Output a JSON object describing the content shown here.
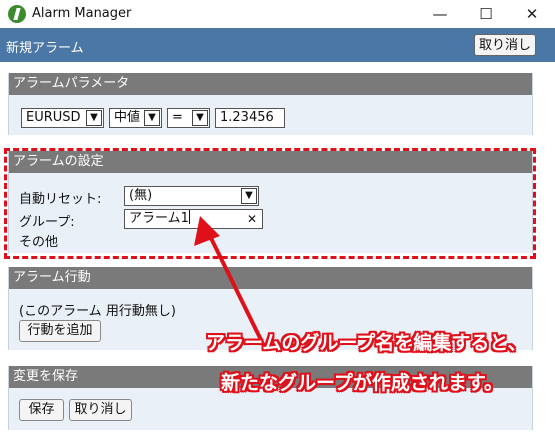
{
  "window": {
    "title": "Alarm Manager",
    "minimize": "—",
    "maximize": "☐",
    "close": "✕"
  },
  "appbar": {
    "title": "新規アラーム",
    "cancel_label": "取り消し"
  },
  "params": {
    "header": "アラームパラメータ",
    "symbol": "EURUSD",
    "price_type": "中値",
    "operator": "=",
    "value": "1.23456"
  },
  "settings": {
    "header": "アラームの設定",
    "auto_reset_label": "自動リセット:",
    "auto_reset_value": "(無)",
    "group_label": "グループ:",
    "group_value": "アラーム1",
    "other_label": "その他"
  },
  "actions": {
    "header": "アラーム行動",
    "none_text": "(このアラーム 用行動無し)",
    "add_button": "行動を追加"
  },
  "save": {
    "header": "変更を保存",
    "save_button": "保存",
    "cancel_button": "取り消し"
  },
  "annotation": {
    "line1": "アラームのグループ名を編集すると、",
    "line2": "新たなグループが作成されます。",
    "color": "#e0101a"
  }
}
